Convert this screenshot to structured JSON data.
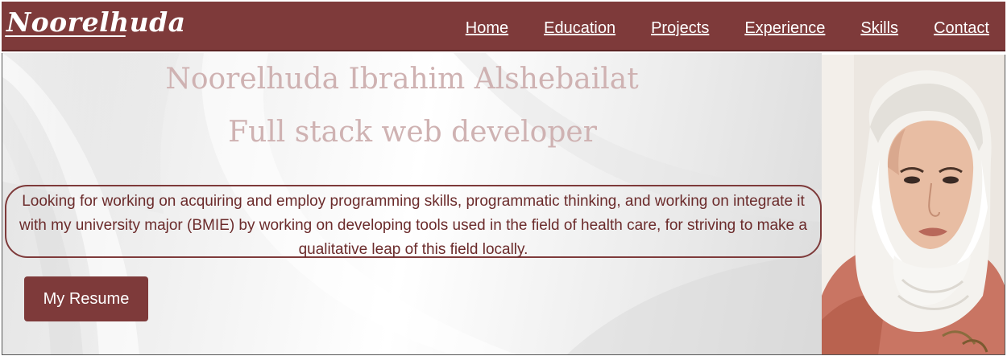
{
  "brand": {
    "logo_text": "Noorelhuda"
  },
  "nav": {
    "items": [
      "Home",
      "Education",
      "Projects",
      "Experience",
      "Skills",
      "Contact"
    ]
  },
  "hero": {
    "name": "Noorelhuda Ibrahim Alshebailat",
    "role": "Full stack web developer",
    "objective": "Looking for working on acquiring and employ programming skills, programmatic thinking, and working on integrate it with my university major (BMIE) by working on developing tools used in the field of health care, for striving to make a qualitative leap of this field locally.",
    "resume_button": "My Resume"
  },
  "colors": {
    "primary": "#7e3a3a",
    "heading_text": "#cfb2b2",
    "objective_text": "#6b2b2b"
  },
  "icons": {
    "profile_photo": "profile-photo"
  }
}
